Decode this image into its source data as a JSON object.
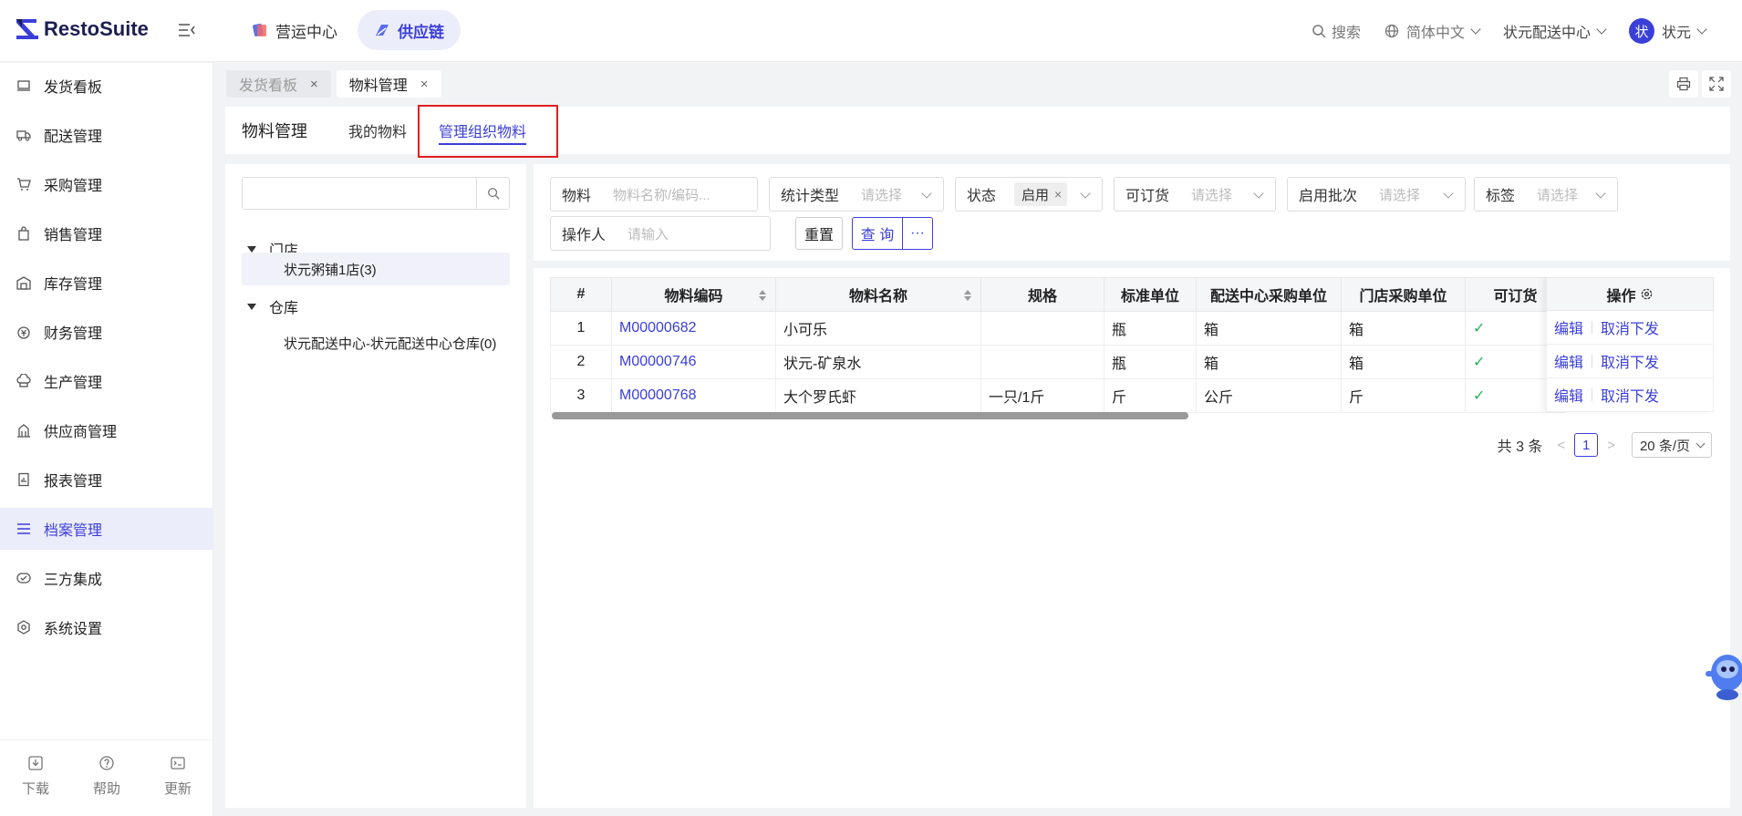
{
  "app": {
    "name": "RestoSuite"
  },
  "topnav": [
    {
      "label": "营运中心",
      "icon": "cube-icon"
    },
    {
      "label": "供应链",
      "icon": "supply-chain-icon"
    }
  ],
  "header_right": {
    "search": "搜索",
    "language": "简体中文",
    "org": "状元配送中心",
    "avatar_char": "状",
    "user": "状元"
  },
  "sidebar": {
    "items": [
      {
        "label": "发货看板",
        "icon": "monitor-icon"
      },
      {
        "label": "配送管理",
        "icon": "truck-icon"
      },
      {
        "label": "采购管理",
        "icon": "cart-icon"
      },
      {
        "label": "销售管理",
        "icon": "bag-icon"
      },
      {
        "label": "库存管理",
        "icon": "warehouse-icon"
      },
      {
        "label": "财务管理",
        "icon": "money-icon"
      },
      {
        "label": "生产管理",
        "icon": "chef-hat-icon"
      },
      {
        "label": "供应商管理",
        "icon": "building-icon"
      },
      {
        "label": "报表管理",
        "icon": "report-icon"
      },
      {
        "label": "档案管理",
        "icon": "list-icon"
      },
      {
        "label": "三方集成",
        "icon": "integration-icon"
      },
      {
        "label": "系统设置",
        "icon": "gear-icon"
      }
    ],
    "bottom": [
      {
        "label": "下载",
        "icon": "download-icon"
      },
      {
        "label": "帮助",
        "icon": "help-icon"
      },
      {
        "label": "更新",
        "icon": "update-icon"
      }
    ]
  },
  "page_tabs": [
    {
      "label": "发货看板",
      "close": "×"
    },
    {
      "label": "物料管理",
      "close": "×"
    }
  ],
  "sub_tabs": {
    "title": "物料管理",
    "my": "我的物料",
    "org": "管理组织物料"
  },
  "tree": {
    "search_placeholder": "",
    "groups": [
      {
        "label": "门店",
        "children": [
          "状元粥铺1店(3)"
        ]
      },
      {
        "label": "仓库",
        "children": [
          "状元配送中心-状元配送中心仓库(0)"
        ]
      }
    ]
  },
  "filters": {
    "material": {
      "label": "物料",
      "placeholder": "物料名称/编码..."
    },
    "stat_type": {
      "label": "统计类型",
      "placeholder": "请选择"
    },
    "status": {
      "label": "状态",
      "tag": "启用",
      "tag_close": "×"
    },
    "orderable": {
      "label": "可订货",
      "placeholder": "请选择"
    },
    "batch": {
      "label": "启用批次",
      "placeholder": "请选择"
    },
    "tag": {
      "label": "标签",
      "placeholder": "请选择"
    },
    "operator": {
      "label": "操作人",
      "placeholder": "请输入"
    },
    "reset": "重置",
    "query": "查 询",
    "more": "···"
  },
  "table": {
    "headers": [
      "#",
      "物料编码",
      "物料名称",
      "规格",
      "标准单位",
      "配送中心采购单位",
      "门店采购单位",
      "可订货"
    ],
    "op_header": "操作",
    "rows": [
      {
        "no": "1",
        "code": "M00000682",
        "name": "小可乐",
        "spec": "",
        "unit": "瓶",
        "dc_unit": "箱",
        "store_unit": "箱",
        "orderable": "✓"
      },
      {
        "no": "2",
        "code": "M00000746",
        "name": "状元-矿泉水",
        "spec": "",
        "unit": "瓶",
        "dc_unit": "箱",
        "store_unit": "箱",
        "orderable": "✓"
      },
      {
        "no": "3",
        "code": "M00000768",
        "name": "大个罗氏虾",
        "spec": "一只/1斤",
        "unit": "斤",
        "dc_unit": "公斤",
        "store_unit": "斤",
        "orderable": "✓"
      }
    ],
    "ops": {
      "edit": "编辑",
      "cancel": "取消下发"
    }
  },
  "pager": {
    "total": "共 3 条",
    "prev": "<",
    "page": "1",
    "next": ">",
    "size": "20 条/页"
  },
  "colors": {
    "accent": "#3b3fd9",
    "highlight": "#e01e1e",
    "check": "#22b35e"
  }
}
